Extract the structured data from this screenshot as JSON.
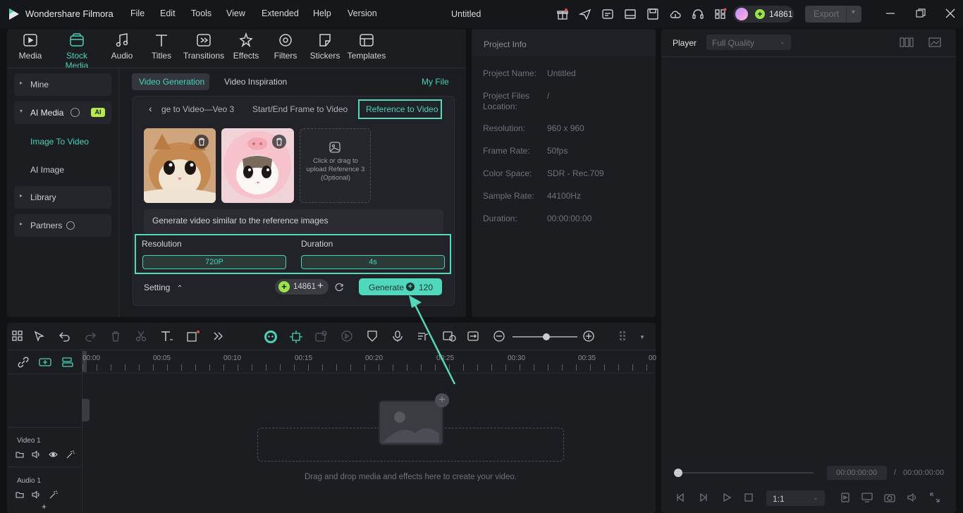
{
  "app": {
    "name": "Wondershare Filmora",
    "project_title": "Untitled",
    "credits": "14861",
    "export_label": "Export"
  },
  "menu": [
    "File",
    "Edit",
    "Tools",
    "View",
    "Extended",
    "Help",
    "Version"
  ],
  "toolbar": [
    "Media",
    "Stock Media",
    "Audio",
    "Titles",
    "Transitions",
    "Effects",
    "Filters",
    "Stickers",
    "Templates"
  ],
  "sidebar": {
    "mine": "Mine",
    "ai_media": "AI Media",
    "ai_badge": "AI",
    "image_to_video": "Image To Video",
    "ai_image": "AI Image",
    "library": "Library",
    "partners": "Partners"
  },
  "ai_panel": {
    "tabs": [
      "Video Generation",
      "Video Inspiration"
    ],
    "my_file": "My File",
    "subtabs": [
      "ge to Video—Veo 3",
      "Start/End Frame to Video",
      "Reference to Video"
    ],
    "upload_text": "Click or drag to upload Reference 3 (Optional)",
    "prompt": "Generate video similar to the reference images",
    "resolution_label": "Resolution",
    "resolution_value": "720P",
    "duration_label": "Duration",
    "duration_value": "4s",
    "setting_label": "Setting",
    "credits": "14861",
    "generate_label": "Generate",
    "generate_cost": "120"
  },
  "project_info": {
    "title": "Project Info",
    "rows": [
      {
        "label": "Project Name:",
        "value": "Untitled"
      },
      {
        "label": "Project Files Location:",
        "value": "/"
      },
      {
        "label": "Resolution:",
        "value": "960 x 960"
      },
      {
        "label": "Frame Rate:",
        "value": "50fps"
      },
      {
        "label": "Color Space:",
        "value": "SDR - Rec.709"
      },
      {
        "label": "Sample Rate:",
        "value": "44100Hz"
      },
      {
        "label": "Duration:",
        "value": "00:00:00:00"
      }
    ]
  },
  "player": {
    "label": "Player",
    "quality": "Full Quality",
    "current_time": "00:00:00:00",
    "separator": "/",
    "total_time": "00:00:00:00",
    "ratio": "1:1"
  },
  "timeline": {
    "ticks": [
      "00:00",
      "00:05",
      "00:10",
      "00:15",
      "00:20",
      "00:25",
      "00:30",
      "00:35",
      "00"
    ],
    "video_track": "Video 1",
    "audio_track": "Audio 1",
    "drop_hint": "Drag and drop media and effects here to create your video."
  }
}
